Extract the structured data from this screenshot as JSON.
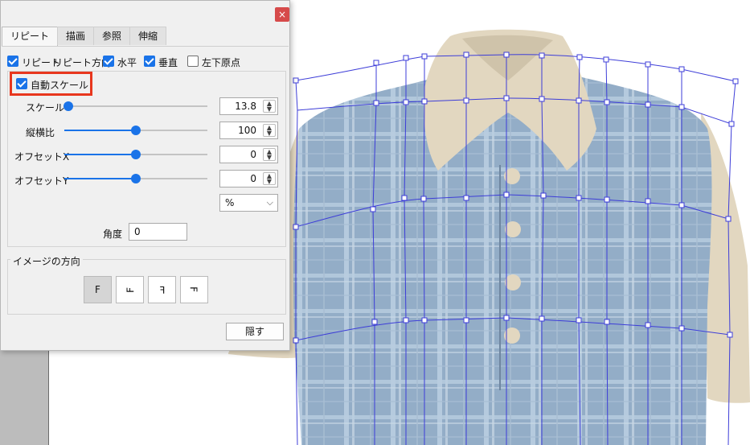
{
  "dialog": {
    "close_glyph": "×",
    "tabs": [
      {
        "label": "リピート",
        "active": true
      },
      {
        "label": "描画",
        "active": false
      },
      {
        "label": "参照",
        "active": false
      },
      {
        "label": "伸縮",
        "active": false
      }
    ],
    "options": {
      "repeat": {
        "label": "リピート",
        "checked": true
      },
      "repeat_direction": "リピート方向",
      "horizontal": {
        "label": "水平",
        "checked": true
      },
      "vertical": {
        "label": "垂直",
        "checked": true
      },
      "bottom_left_origin": {
        "label": "左下原点",
        "checked": false
      }
    },
    "auto_scale": {
      "label": "自動スケール",
      "checked": true
    },
    "sliders": {
      "scale": {
        "label": "スケール",
        "value": "13.8",
        "level": 0.0
      },
      "aspect": {
        "label": "縦横比",
        "value": "100",
        "level": 0.5
      },
      "offset_x": {
        "label": "オフセットX",
        "value": "0",
        "level": 0.5
      },
      "offset_y": {
        "label": "オフセットY",
        "value": "0",
        "level": 0.5
      }
    },
    "unit_select": "%",
    "angle": {
      "label": "角度",
      "value": "0"
    },
    "orientation": {
      "title": "イメージの方向",
      "buttons": [
        "F",
        "Ⅎ",
        "Ⅎ",
        "Ⅎ"
      ],
      "selected_index": 0
    },
    "hide_button": "隠す"
  },
  "colors": {
    "accent": "#1a73e8",
    "highlight_border": "#e8371e",
    "close_button": "#d64a4a",
    "shirt_plaid": "#93adc7",
    "collar_sleeve": "#e2d7c0",
    "mesh": "#3d3dd8"
  }
}
